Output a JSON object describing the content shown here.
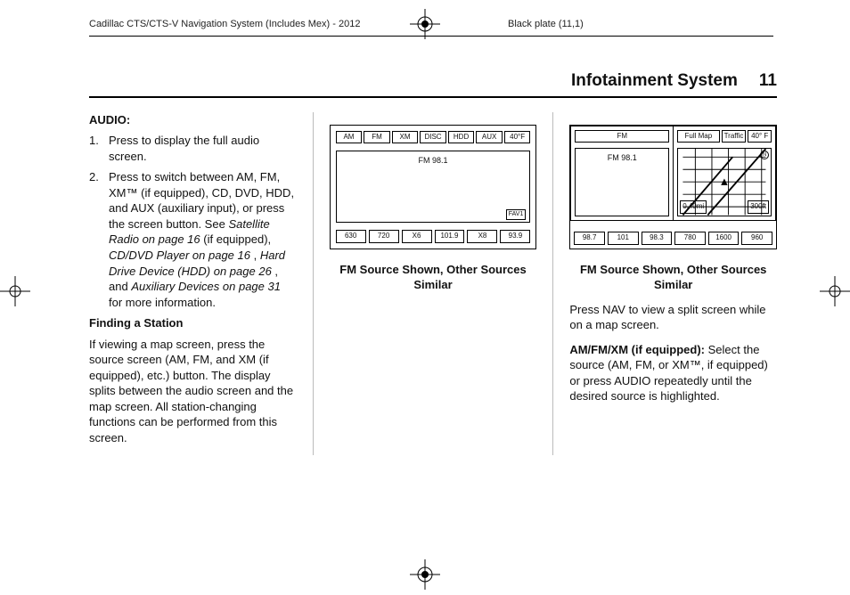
{
  "printer": {
    "left_note": "Cadillac CTS/CTS-V Navigation System (Includes Mex) - 2012",
    "right_note": "Black plate (11,1)"
  },
  "running_head": {
    "section": "Infotainment System",
    "page": "11"
  },
  "col1": {
    "audio_heading": "AUDIO:",
    "step1_n": "1.",
    "step1": "Press to display the full audio screen.",
    "step2_n": "2.",
    "step2_pre": " Press to switch between AM, FM, XM™ (if equipped), CD, DVD, HDD, and AUX (auxiliary input), or press the screen button. See ",
    "step2_i1": "Satellite Radio on page 16",
    "step2_mid1": " (if equipped), ",
    "step2_i2": "CD/DVD Player on page 16",
    "step2_mid2": ", ",
    "step2_i3": "Hard Drive Device (HDD) on page 26",
    "step2_mid3": ", and ",
    "step2_i4": "Auxiliary Devices on page 31",
    "step2_post": " for more information.",
    "finding_heading": "Finding a Station",
    "finding_body": "If viewing a map screen, press the source screen (AM, FM, and XM (if equipped), etc.) button. The display splits between the audio screen and the map screen. All station-changing functions can be performed from this screen."
  },
  "col2": {
    "fig": {
      "tabs": [
        "AM",
        "FM",
        "XM",
        "DISC",
        "HDD",
        "AUX",
        "40°F"
      ],
      "station": "FM 98.1",
      "fav": "FAV1",
      "presets": [
        "630",
        "720",
        "X6",
        "101.9",
        "X8",
        "93.9"
      ]
    },
    "caption": "FM Source Shown, Other Sources Similar"
  },
  "col3": {
    "fig": {
      "fm": "FM",
      "fullmap": "Full Map",
      "traffic": "Traffic",
      "temp": "40° F",
      "station": "FM 98.1",
      "distance": "0.40mi",
      "scale": "300ft",
      "presets": [
        "98.7",
        "101",
        "98.3",
        "780",
        "1600",
        "960"
      ]
    },
    "caption": "FM Source Shown, Other Sources Similar",
    "p1": "Press NAV to view a split screen while on a map screen.",
    "p2_lead": "AM/FM/XM (if equipped):",
    "p2_body": "  Select the source (AM, FM, or XM™, if equipped) or press AUDIO repeatedly until the desired source is highlighted."
  }
}
